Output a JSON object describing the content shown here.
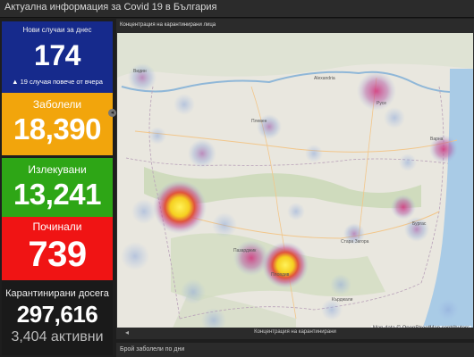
{
  "header": {
    "title": "Актуална информация за Covid 19 в България"
  },
  "cards": {
    "new": {
      "label": "Нови случаи за днес",
      "value": "174",
      "sub": "▲ 19 случая повече от вчера"
    },
    "sick": {
      "label": "Заболели",
      "value": "18,390"
    },
    "recovered": {
      "label": "Излекувани",
      "value": "13,241"
    },
    "deceased": {
      "label": "Починали",
      "value": "739"
    },
    "quarantined": {
      "label": "Карантинирани досега",
      "value": "297,616",
      "sub": "3,404 активни"
    }
  },
  "map": {
    "title": "Концентрация на карантинирани лица",
    "attribution": "Map data © OpenStreetMap contributors",
    "cities": [
      "Видин",
      "Русе",
      "Alexandria",
      "Плевен",
      "Варна",
      "Бургас",
      "Стара Загора",
      "Пловдив",
      "Пазарджик",
      "Кърджали"
    ],
    "footer": "Концентрация на карантинирани",
    "hotspots": [
      {
        "intensity": "high",
        "color": "#f5e12a"
      },
      {
        "intensity": "high",
        "color": "#f0c81e"
      },
      {
        "intensity": "medium",
        "color": "#d53a7a"
      }
    ]
  },
  "bottom": {
    "title": "Брой заболели по дни"
  },
  "colors": {
    "new": "#162a8c",
    "sick": "#f2a50c",
    "recovered": "#2ea616",
    "deceased": "#f01414",
    "quarantined": "#1a1a1a"
  }
}
